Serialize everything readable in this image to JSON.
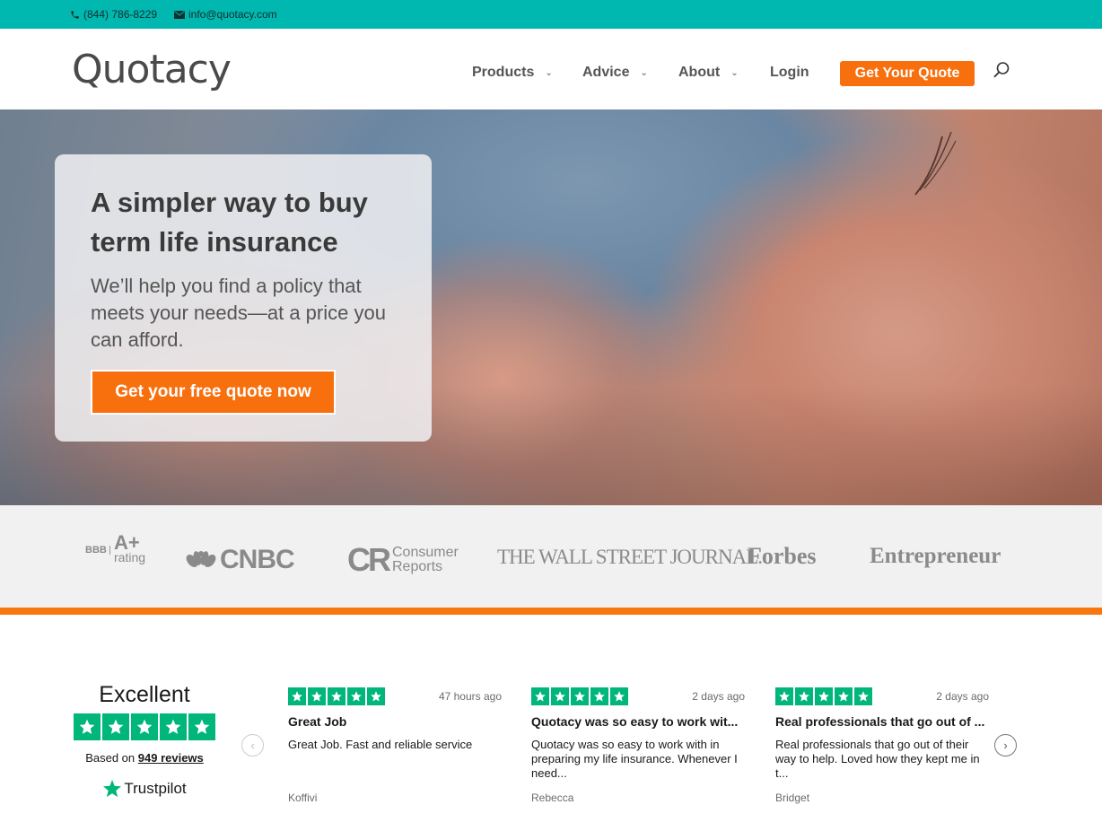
{
  "topbar": {
    "phone": "(844) 786-8229",
    "email": "info@quotacy.com",
    "phone_icon": "phone-icon",
    "email_icon": "envelope-icon"
  },
  "header": {
    "logo": "Quotacy",
    "nav": [
      {
        "label": "Products",
        "has_dropdown": true
      },
      {
        "label": "Advice",
        "has_dropdown": true
      },
      {
        "label": "About",
        "has_dropdown": true
      },
      {
        "label": "Login",
        "has_dropdown": false
      }
    ],
    "cta_label": "Get Your Quote",
    "search_icon": "search-icon"
  },
  "hero": {
    "title": "A simpler way to buy term life insurance",
    "subtitle": "We’ll help you find a policy that meets your needs—at a price you can afford.",
    "cta_label": "Get your free quote now"
  },
  "press": {
    "bbb": {
      "mark": "BBB",
      "grade": "A+",
      "label": "rating"
    },
    "cnbc": "CNBC",
    "consumer_reports": {
      "mark": "CR",
      "line1": "Consumer",
      "line2": "Reports"
    },
    "wsj": "THE WALL STREET JOURNAL.",
    "forbes": "Forbes",
    "entrepreneur": "Entrepreneur"
  },
  "trustpilot": {
    "rating_word": "Excellent",
    "stars": 5,
    "based_on_prefix": "Based on",
    "review_count_label": "949 reviews",
    "brand": "Trustpilot",
    "reviews": [
      {
        "time": "47 hours ago",
        "title": "Great Job",
        "body": "Great Job. Fast and reliable service",
        "author": "Koffivi",
        "stars": 5
      },
      {
        "time": "2 days ago",
        "title": "Quotacy was so easy to work wit...",
        "body": "Quotacy was so easy to work with in preparing my life insurance. Whenever I need...",
        "author": "Rebecca",
        "stars": 5
      },
      {
        "time": "2 days ago",
        "title": "Real professionals that go out of ...",
        "body": "Real professionals that go out of their way to help. Loved how they kept me in t...",
        "author": "Bridget",
        "stars": 5
      }
    ]
  },
  "colors": {
    "topbar": "#00b8b0",
    "accent_orange": "#f86f0e",
    "trustpilot_green": "#00b67a"
  }
}
